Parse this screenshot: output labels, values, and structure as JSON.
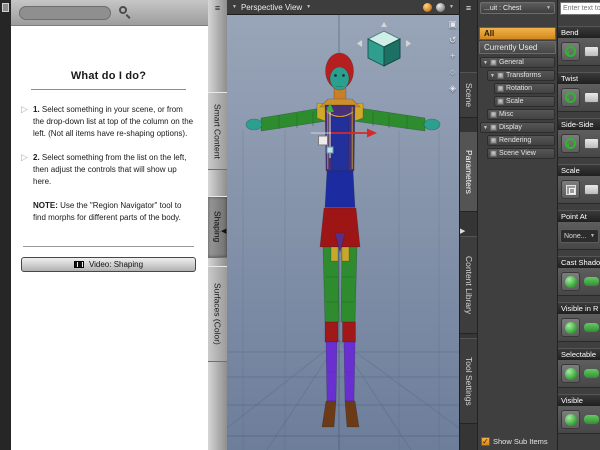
{
  "icons": {
    "menu": "≡",
    "dropdown": "▼",
    "collapse_left": "◀",
    "collapse_right": "▶",
    "bullet": "▷",
    "check": "✓",
    "expand": "▼"
  },
  "colors": {
    "accent_orange": "#E09A2F",
    "dial_green": "#2FAE2F"
  },
  "left_panel": {
    "search_placeholder": "",
    "title": "What do I do?",
    "steps": [
      {
        "prefix": "1.",
        "text": " Select something in your scene, or from the drop-down list at top of the column on the left. (Not all items have re-shaping options)."
      },
      {
        "prefix": "2.",
        "text": " Select something from the list on the left, then adjust the controls that will show up here."
      }
    ],
    "note": {
      "prefix": "NOTE:",
      "text": " Use the \"Region Navigator\" tool to find morphs for different parts of the body."
    },
    "video_button": "Video: Shaping"
  },
  "left_tabs": [
    {
      "label": "Smart Content"
    },
    {
      "label": "Shaping"
    },
    {
      "label": "Surfaces (Color)"
    }
  ],
  "viewport": {
    "view_selector": "Perspective View",
    "tools": [
      {
        "name": "cube-tool",
        "glyph": "▣"
      },
      {
        "name": "orbit-tool",
        "glyph": "↺"
      },
      {
        "name": "pan-tool",
        "glyph": "+"
      },
      {
        "name": "dolly-tool",
        "glyph": "○"
      },
      {
        "name": "frame-tool",
        "glyph": "◈"
      }
    ]
  },
  "right_tabs": [
    {
      "label": "Scene"
    },
    {
      "label": "Parameters"
    },
    {
      "label": "Content Library"
    },
    {
      "label": "Tool Settings"
    }
  ],
  "parameters_panel": {
    "node_selector": "...uit : Chest",
    "filters": [
      {
        "label": "All"
      },
      {
        "label": "Currently Used"
      }
    ],
    "tree": [
      {
        "label": "General"
      },
      {
        "label": "Transforms"
      },
      {
        "label": "Rotation"
      },
      {
        "label": "Scale"
      },
      {
        "label": "Misc"
      },
      {
        "label": "Display"
      },
      {
        "label": "Rendering"
      },
      {
        "label": "Scene View"
      }
    ],
    "show_sub_items": "Show Sub Items"
  },
  "sliders_panel": {
    "search_placeholder": "Enter text to f",
    "params": [
      {
        "label": "Bend",
        "type": "dial"
      },
      {
        "label": "Twist",
        "type": "dial"
      },
      {
        "label": "Side-Side",
        "type": "dial"
      },
      {
        "label": "Scale",
        "type": "scale"
      },
      {
        "label": "Point At",
        "type": "pointat",
        "value": "None..."
      },
      {
        "label": "Cast Shado",
        "type": "toggle"
      },
      {
        "label": "Visible in R",
        "type": "toggle"
      },
      {
        "label": "Selectable",
        "type": "toggle"
      },
      {
        "label": "Visible",
        "type": "toggle"
      }
    ]
  }
}
